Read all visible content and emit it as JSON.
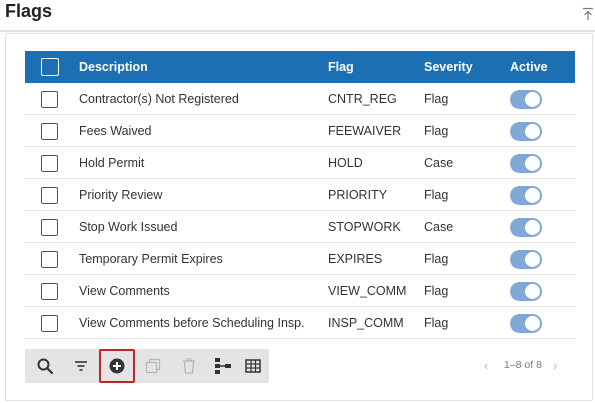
{
  "panel": {
    "title": "Flags"
  },
  "table": {
    "headers": {
      "description": "Description",
      "flag": "Flag",
      "severity": "Severity",
      "active": "Active"
    },
    "rows": [
      {
        "description": "Contractor(s) Not Registered",
        "flag": "CNTR_REG",
        "severity": "Flag",
        "active": true
      },
      {
        "description": "Fees Waived",
        "flag": "FEEWAIVER",
        "severity": "Flag",
        "active": true
      },
      {
        "description": "Hold Permit",
        "flag": "HOLD",
        "severity": "Case",
        "active": true
      },
      {
        "description": "Priority Review",
        "flag": "PRIORITY",
        "severity": "Flag",
        "active": true
      },
      {
        "description": "Stop Work Issued",
        "flag": "STOPWORK",
        "severity": "Case",
        "active": true
      },
      {
        "description": "Temporary Permit Expires",
        "flag": "EXPIRES",
        "severity": "Flag",
        "active": true
      },
      {
        "description": "View Comments",
        "flag": "VIEW_COMM",
        "severity": "Flag",
        "active": true
      },
      {
        "description": "View Comments before Scheduling Insp.",
        "flag": "INSP_COMM",
        "severity": "Flag",
        "active": true
      }
    ]
  },
  "toolbar": {
    "buttons": [
      "search-icon",
      "filter-icon",
      "add-icon",
      "copy-icon",
      "delete-icon",
      "hierarchy-icon",
      "grid-icon"
    ]
  },
  "pager": {
    "label": "1–8 of 8"
  },
  "colors": {
    "header": "#1c6fb3",
    "toggle": "#7fa9d6",
    "highlight": "#c0262d"
  }
}
